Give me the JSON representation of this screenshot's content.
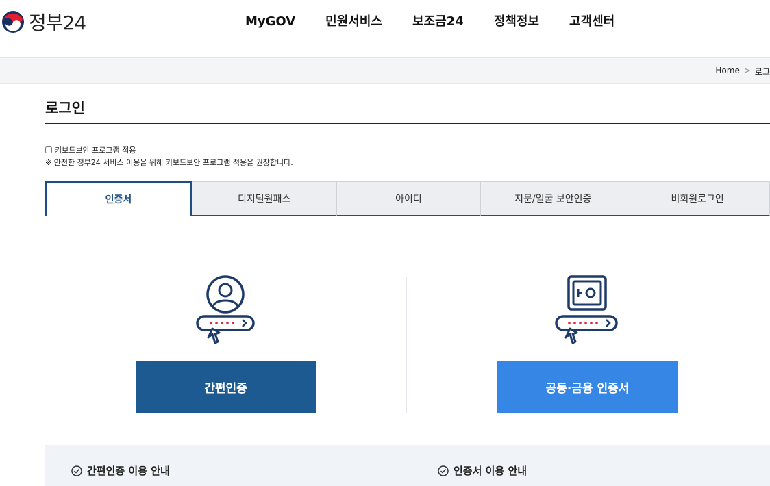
{
  "header": {
    "logo_text": "정부24",
    "nav": [
      "MyGOV",
      "민원서비스",
      "보조금24",
      "정책정보",
      "고객센터"
    ]
  },
  "breadcrumb": {
    "home": "Home",
    "sep": ">",
    "current": "로그"
  },
  "page": {
    "title": "로그인",
    "keyboard_security_label": "키보드보안 프로그램 적용",
    "keyboard_security_note": "※ 안전한 정부24 서비스 이용을 위해 키보드보안 프로그램 적용을 권장합니다."
  },
  "tabs": [
    "인증서",
    "디지털원패스",
    "아이디",
    "지문/얼굴 보안인증",
    "비회원로그인"
  ],
  "login": {
    "simple_auth_button": "간편인증",
    "cert_button": "공동·금융 인증서"
  },
  "info": {
    "simple_guide": "간편인증 이용 안내",
    "cert_guide": "인증서 이용 안내"
  },
  "colors": {
    "primary_dark": "#1d5a91",
    "primary_light": "#3686e6",
    "tab_border": "#1d4f83"
  }
}
